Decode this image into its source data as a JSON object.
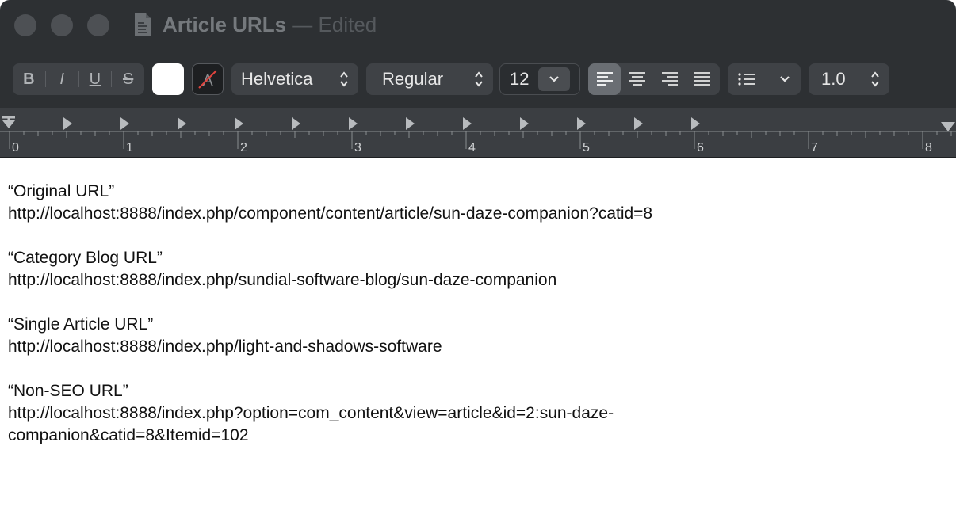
{
  "window": {
    "title": "Article URLs",
    "title_separator": "—",
    "edited_label": "Edited"
  },
  "toolbar": {
    "bold_label": "B",
    "italic_label": "I",
    "underline_label": "U",
    "strikethrough_label": "S",
    "font_family": "Helvetica",
    "font_style": "Regular",
    "font_size": "12",
    "line_spacing": "1.0",
    "text_color": "#ffffff",
    "alignment_selected": "left"
  },
  "ruler": {
    "labels": [
      "0",
      "1",
      "2",
      "3",
      "4",
      "5",
      "6",
      "7",
      "8"
    ]
  },
  "document": {
    "paragraphs": [
      {
        "heading": "“Original URL”",
        "lines": [
          "http://localhost:8888/index.php/component/content/article/sun-daze-companion?catid=8"
        ]
      },
      {
        "heading": "“Category Blog URL”",
        "lines": [
          "http://localhost:8888/index.php/sundial-software-blog/sun-daze-companion"
        ]
      },
      {
        "heading": "“Single Article URL”",
        "lines": [
          "http://localhost:8888/index.php/light-and-shadows-software"
        ]
      },
      {
        "heading": "“Non-SEO URL”",
        "lines": [
          "http://localhost:8888/index.php?option=com_content&view=article&id=2:sun-daze-",
          "companion&catid=8&Itemid=102"
        ]
      }
    ]
  }
}
